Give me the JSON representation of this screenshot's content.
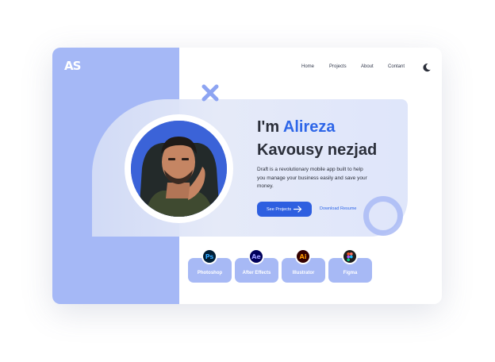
{
  "brand": {
    "logo_text": "AS"
  },
  "nav": {
    "home": "Home",
    "projects": "Projects",
    "about": "About",
    "contact": "Contant"
  },
  "hero": {
    "greeting": "I'm ",
    "first_name": "Alireza",
    "last_name": "Kavousy nezjad",
    "description": "Draft is a revolutionary mobile app built to help you manage your business easily and save your money.",
    "cta_projects": "See Projects",
    "cta_resume": "Download Resume"
  },
  "skills": [
    {
      "label": "Photoshop",
      "icon_text": "Ps",
      "icon_color": "#31a8ff",
      "icon_bg": "#001e36"
    },
    {
      "label": "After Effects",
      "icon_text": "Ae",
      "icon_color": "#9999ff",
      "icon_bg": "#00005b"
    },
    {
      "label": "Illustrator",
      "icon_text": "Ai",
      "icon_color": "#ff9a00",
      "icon_bg": "#330000"
    },
    {
      "label": "Figma",
      "icon_text": "",
      "icon_color": "#f24e1e",
      "icon_bg": "#1e1e1e"
    }
  ],
  "colors": {
    "accent": "#2e66e8",
    "panel": "#a5b8f6",
    "text": "#2b2f3a"
  }
}
